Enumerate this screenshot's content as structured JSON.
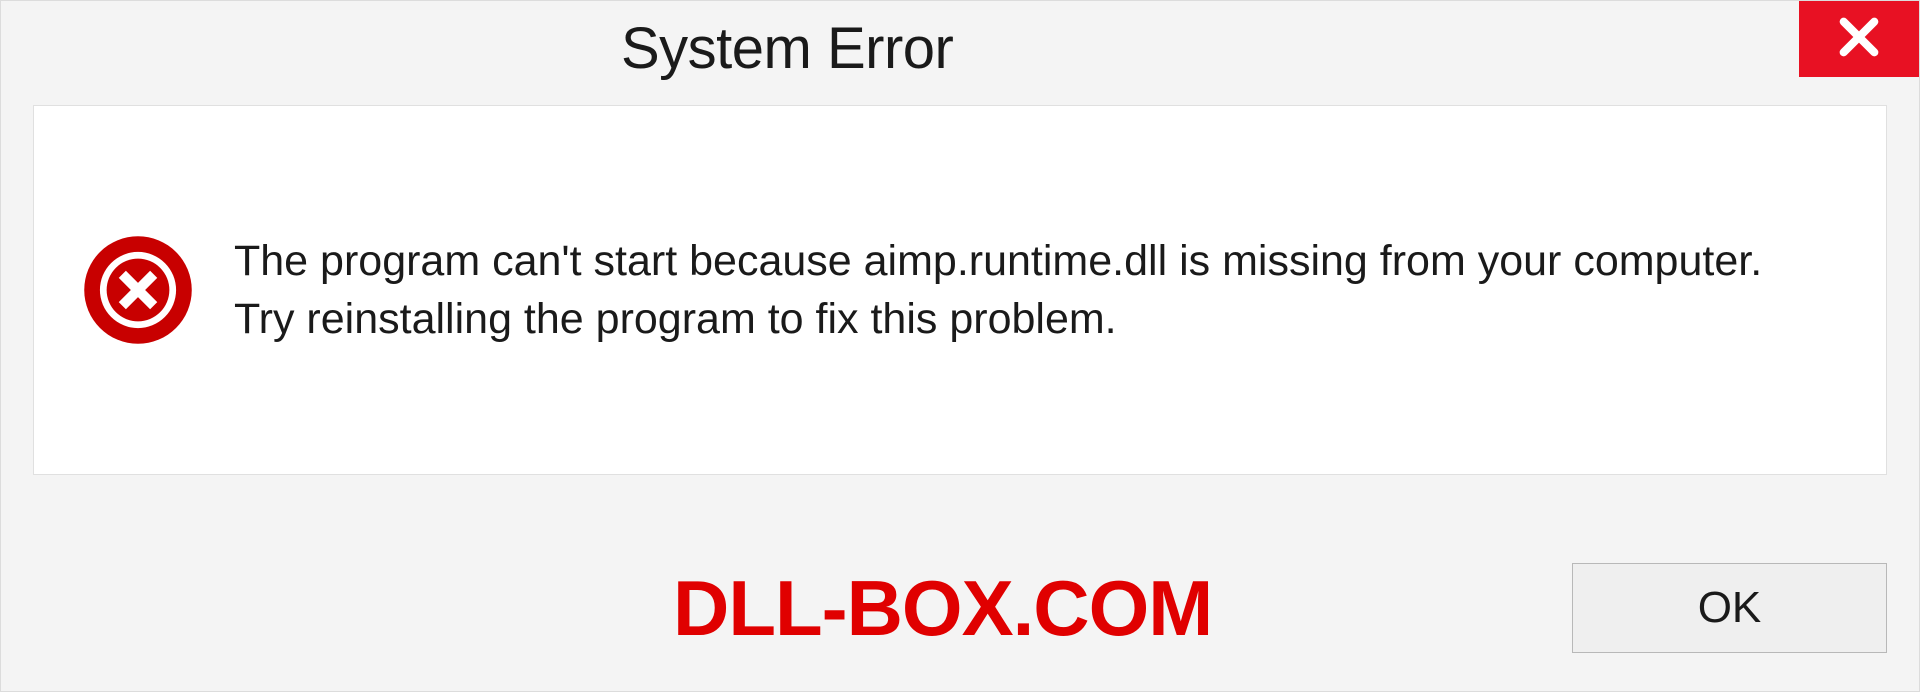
{
  "dialog": {
    "title": "System Error",
    "message": "The program can't start because aimp.runtime.dll is missing from your computer. Try reinstalling the program to fix this problem.",
    "ok_label": "OK"
  },
  "watermark": "DLL-BOX.COM",
  "colors": {
    "close_bg": "#e81123",
    "error_icon": "#c80000",
    "watermark": "#e00000"
  }
}
